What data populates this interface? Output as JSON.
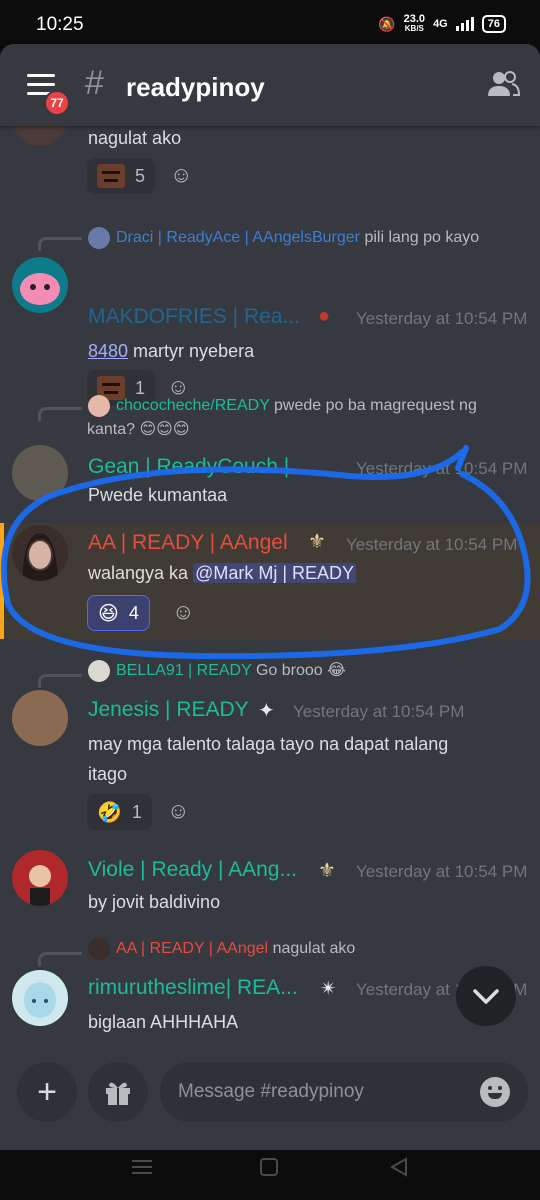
{
  "status_bar": {
    "time": "10:25",
    "net_speed": "23.0",
    "net_unit": "KB/S",
    "net_type": "4G",
    "battery": "76"
  },
  "header": {
    "unread_badge": "77",
    "hash": "#",
    "channel_name": "readypinoy"
  },
  "messages": [
    {
      "text": "nagulat ako",
      "reaction_count": "5"
    },
    {
      "reply_author": "Draci | ReadyAce | AAngelsBurger",
      "reply_text": "pili lang po kayo",
      "username": "MAKDOFRIES | Rea...",
      "timestamp": "Yesterday at 10:54 PM",
      "text_link": "8480",
      "text": " martyr nyebera",
      "reaction_count": "1"
    },
    {
      "reply_author": "chococheche/READY",
      "reply_text": "pwede po ba magrequest ng",
      "reply_text2": "kanta? 😊😊😊",
      "username": "Gean | ReadyCouch |",
      "timestamp": "Yesterday at 10:54 PM",
      "text": "Pwede kumantaa"
    },
    {
      "username": "AA | READY | AAngel",
      "timestamp": "Yesterday at 10:54 PM",
      "text": "walangya ka ",
      "mention": "@Mark Mj | READY",
      "reaction_emoji": "😆",
      "reaction_count": "4"
    },
    {
      "reply_author": "BELLA91 | READY",
      "reply_text": "Go brooo 😂",
      "username": "Jenesis | READY",
      "timestamp": "Yesterday at 10:54 PM",
      "text": "may mga talento talaga tayo na dapat nalang",
      "text2": "itago",
      "reaction_emoji": "🤣",
      "reaction_count": "1"
    },
    {
      "username": "Viole | Ready | AAng...",
      "timestamp": "Yesterday at 10:54 PM",
      "text": "by jovit baldivino"
    },
    {
      "reply_author": "AA | READY | AAngel",
      "reply_text": "nagulat ako",
      "username": "rimurutheslime| REA...",
      "timestamp": "Yesterday at 10:54 PM",
      "text": "biglaan AHHHAHA"
    }
  ],
  "composer": {
    "placeholder": "Message #readypinoy"
  },
  "colors": {
    "background": "#36393f",
    "accent": "#5865f2",
    "highlight": "#faa61a",
    "circle_annotation": "#1a6cf0"
  }
}
